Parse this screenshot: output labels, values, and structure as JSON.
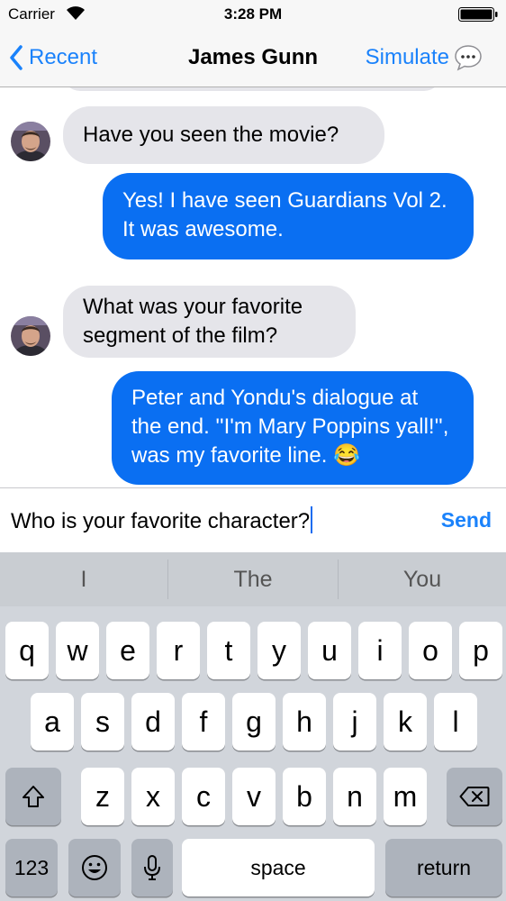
{
  "status_bar": {
    "carrier": "Carrier",
    "time": "3:28 PM"
  },
  "nav": {
    "back_label": "Recent",
    "title": "James Gunn",
    "simulate_label": "Simulate",
    "simulate_icon": "speech-bubble-ellipsis-icon"
  },
  "messages": [
    {
      "from": "contact",
      "text": "Have you seen the movie?"
    },
    {
      "from": "me",
      "text": "Yes! I have seen Guardians Vol 2. It was awesome."
    },
    {
      "from": "contact",
      "text": "What was your favorite segment of the film?"
    },
    {
      "from": "me",
      "text": "Peter and Yondu's dialogue at the end. ''I'm Mary Poppins yall!'', was my favorite line. 😂"
    }
  ],
  "input": {
    "value": "Who is your favorite character?",
    "send_label": "Send"
  },
  "keyboard": {
    "suggestions": [
      "I",
      "The",
      "You"
    ],
    "row1": [
      "q",
      "w",
      "e",
      "r",
      "t",
      "y",
      "u",
      "i",
      "o",
      "p"
    ],
    "row2": [
      "a",
      "s",
      "d",
      "f",
      "g",
      "h",
      "j",
      "k",
      "l"
    ],
    "row3": [
      "z",
      "x",
      "c",
      "v",
      "b",
      "n",
      "m"
    ],
    "numbers_label": "123",
    "space_label": "space",
    "return_label": "return"
  },
  "colors": {
    "accent": "#1a82fb",
    "outgoing_bubble": "#0a6ff2",
    "incoming_bubble": "#e5e5ea",
    "keyboard_bg": "#d1d5db"
  }
}
